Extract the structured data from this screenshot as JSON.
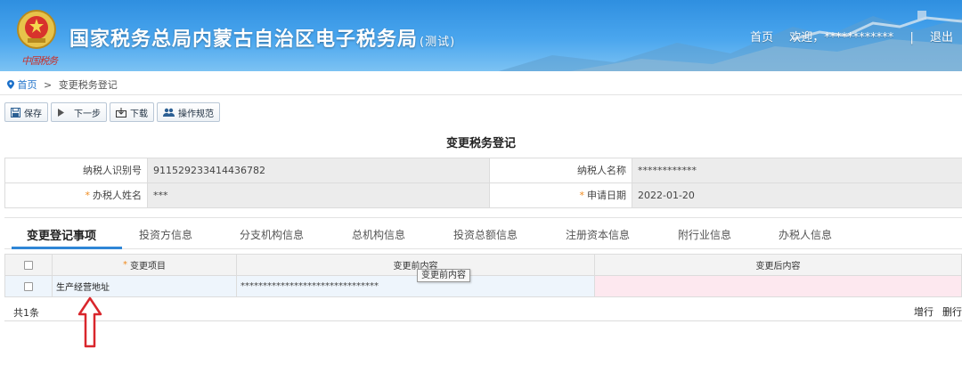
{
  "header": {
    "site_title": "国家税务总局内蒙古自治区电子税务局",
    "test_tag": "(测试)",
    "signature": "中国税务",
    "nav": {
      "home": "首页",
      "welcome": "欢迎，************",
      "separator": "|",
      "logout": "退出"
    }
  },
  "breadcrumb": {
    "home": "首页",
    "separator": ">",
    "current": "变更税务登记"
  },
  "toolbar": {
    "save": "保存",
    "next": "下一步",
    "download": "下载",
    "guide": "操作规范"
  },
  "form": {
    "title": "变更税务登记",
    "fields": {
      "taxpayer_id_label": "纳税人识别号",
      "taxpayer_id_value": "911529233414436782",
      "taxpayer_name_label": "纳税人名称",
      "taxpayer_name_value": "************",
      "handler_name_label": "办税人姓名",
      "handler_name_value": "***",
      "apply_date_label": "申请日期",
      "apply_date_value": "2022-01-20",
      "required_mark": "*"
    }
  },
  "tabs": [
    {
      "label": "变更登记事项",
      "active": true
    },
    {
      "label": "投资方信息"
    },
    {
      "label": "分支机构信息"
    },
    {
      "label": "总机构信息"
    },
    {
      "label": "投资总额信息"
    },
    {
      "label": "注册资本信息"
    },
    {
      "label": "附行业信息"
    },
    {
      "label": "办税人信息"
    }
  ],
  "table": {
    "required_mark": "*",
    "columns": {
      "item": "变更项目",
      "before": "变更前内容",
      "after": "变更后内容"
    },
    "rows": [
      {
        "item": "生产经营地址",
        "before": "*******************************",
        "after": ""
      }
    ],
    "tooltip": "变更前内容",
    "total": "共1条",
    "add_row": "增行",
    "delete_row": "删行"
  },
  "colors": {
    "header_blue": "#3a99e6",
    "accent_blue": "#2f86d6",
    "required_orange": "#f08a1c",
    "arrow_red": "#d9262c"
  }
}
